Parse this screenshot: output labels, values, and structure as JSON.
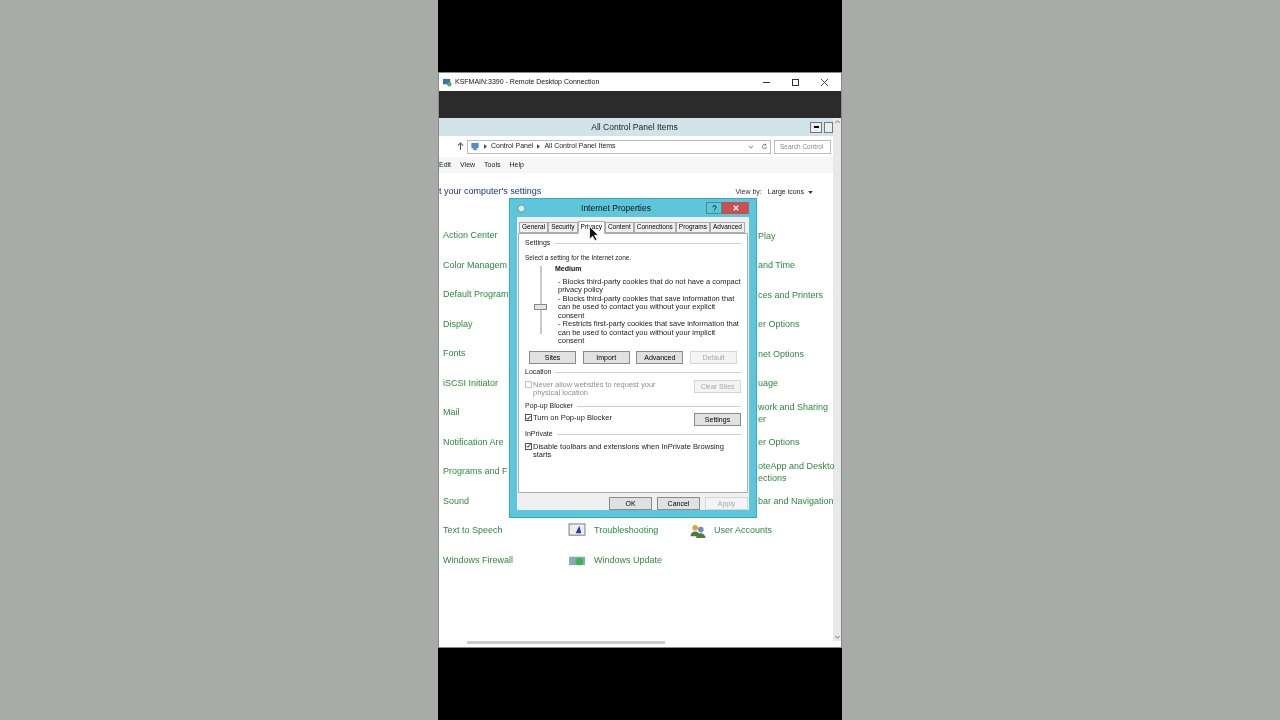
{
  "rdp_window": {
    "title": "KSFMAIN:3390 - Remote Desktop Connection"
  },
  "control_panel": {
    "title": "All Control Panel Items",
    "breadcrumb": [
      "Control Panel",
      "All Control Panel Items"
    ],
    "search": {
      "placeholder": "Search Control"
    },
    "menu": [
      "Edit",
      "View",
      "Tools",
      "Help"
    ],
    "heading": "t your computer's settings",
    "view_by_label": "View by:",
    "view_by_value": "Large icons",
    "rows": [
      {
        "left": "Action Center",
        "right": [
          "Play"
        ]
      },
      {
        "left": "Color Managem",
        "right": [
          "and Time"
        ]
      },
      {
        "left": "Default Program",
        "right": [
          "ces and Printers"
        ]
      },
      {
        "left": "Display",
        "right": [
          "er Options"
        ]
      },
      {
        "left": "Fonts",
        "right": [
          "net Options"
        ]
      },
      {
        "left": "iSCSI Initiator",
        "right": [
          "uage"
        ]
      },
      {
        "left": "Mail",
        "right": [
          "work and Sharing",
          "er"
        ]
      },
      {
        "left": "Notification Are",
        "right": [
          "er Options"
        ]
      },
      {
        "left": "Programs and F",
        "right": [
          "oteApp and Deskto",
          "ections"
        ]
      },
      {
        "left": "Sound",
        "right": [
          "bar and Navigation"
        ]
      },
      {
        "left": "Text to Speech",
        "middle": "Troubleshooting",
        "right_full": "User Accounts"
      },
      {
        "left": "Windows Firewall",
        "middle": "Windows Update"
      }
    ]
  },
  "dialog": {
    "title": "Internet Properties",
    "tabs": [
      {
        "label": "General",
        "selected": false
      },
      {
        "label": "Security",
        "selected": false
      },
      {
        "label": "Privacy",
        "selected": true
      },
      {
        "label": "Content",
        "selected": false
      },
      {
        "label": "Connections",
        "selected": false
      },
      {
        "label": "Programs",
        "selected": false
      },
      {
        "label": "Advanced",
        "selected": false
      }
    ],
    "settings_label": "Settings",
    "zone_text": "Select a setting for the Internet zone.",
    "privacy_level": {
      "name": "Medium",
      "level": 0.4
    },
    "description": [
      "- Blocks third-party cookies that do not have a compact privacy policy",
      "- Blocks third-party cookies that save information that can be used to contact you without your explicit consent",
      "- Restricts first-party cookies that save information that can be used to contact you without your implicit consent"
    ],
    "setting_buttons": [
      {
        "label": "Sites",
        "disabled": false
      },
      {
        "label": "Import",
        "disabled": false
      },
      {
        "label": "Advanced",
        "disabled": false
      },
      {
        "label": "Default",
        "disabled": true
      }
    ],
    "sections": [
      {
        "title": "Location",
        "checkbox": {
          "label": "Never allow websites to request your physical location",
          "checked": false,
          "disabled": true
        },
        "button": {
          "label": "Clear Sites",
          "disabled": true
        }
      },
      {
        "title": "Pop-up Blocker",
        "checkbox": {
          "label": "Turn on Pop-up Blocker",
          "checked": true,
          "disabled": false
        },
        "button": {
          "label": "Settings",
          "disabled": false
        }
      },
      {
        "title": "InPrivate",
        "checkbox": {
          "label": "Disable toolbars and extensions when InPrivate Browsing starts",
          "checked": true,
          "disabled": false
        }
      }
    ],
    "footer_buttons": [
      {
        "label": "OK",
        "disabled": false
      },
      {
        "label": "Cancel",
        "disabled": false
      },
      {
        "label": "Apply",
        "disabled": true
      }
    ]
  }
}
